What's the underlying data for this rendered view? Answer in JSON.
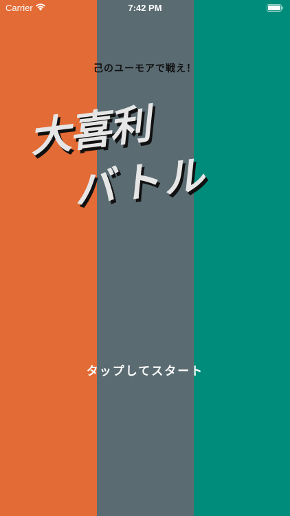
{
  "status_bar": {
    "carrier": "Carrier",
    "time": "7:42 PM",
    "wifi_icon": "wifi-icon",
    "battery_icon": "battery-icon"
  },
  "colors": {
    "stripe_left": "#e36b35",
    "stripe_middle": "#5a6b72",
    "stripe_right": "#008c7a"
  },
  "subtitle": "己のユーモアで戦え！",
  "title": {
    "line1": "大喜利",
    "line2": "バトル"
  },
  "start_prompt": "タップしてスタート"
}
